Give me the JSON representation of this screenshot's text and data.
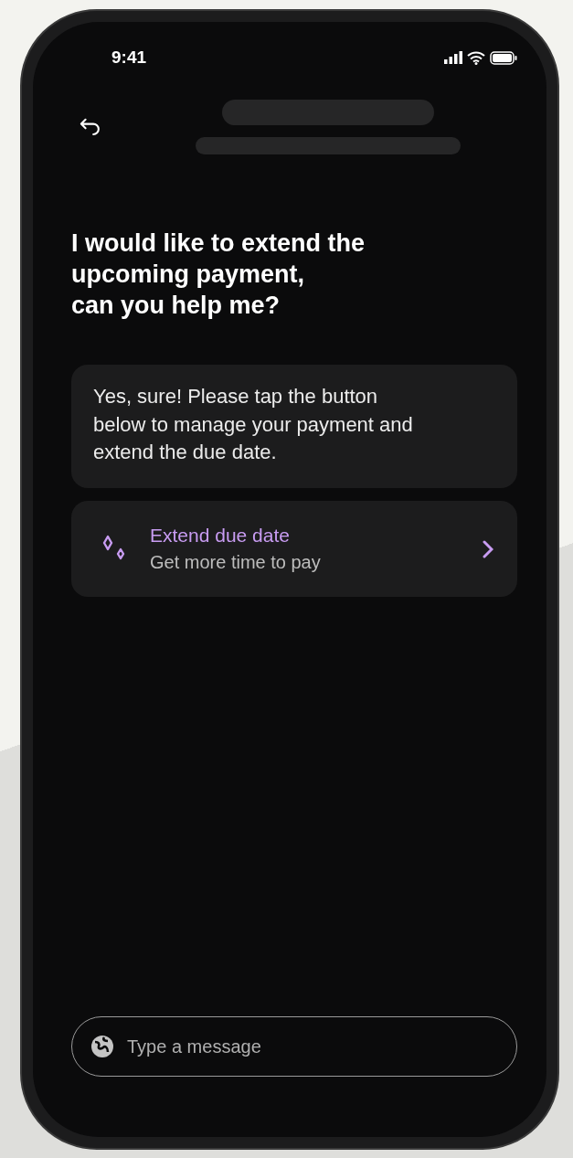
{
  "status_bar": {
    "time": "9:41"
  },
  "user_message": {
    "lines": [
      "I would like to extend the",
      "upcoming payment,",
      "can you help me?"
    ]
  },
  "reply": {
    "text": "Yes, sure! Please tap the button below to manage your payment and extend the due date."
  },
  "action": {
    "title": "Extend due date",
    "subtitle": "Get more time to pay"
  },
  "composer": {
    "placeholder": "Type a message"
  }
}
